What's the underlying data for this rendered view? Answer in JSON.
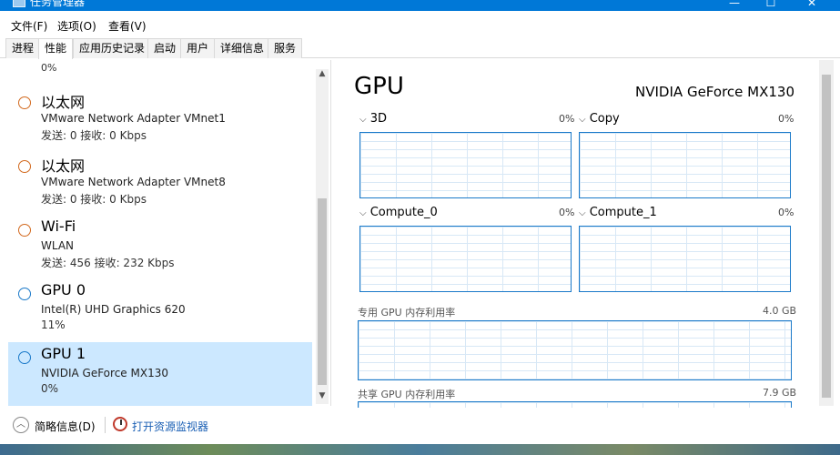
{
  "window": {
    "title": "任务管理器",
    "controls": {
      "minimize": "—",
      "maximize": "☐",
      "close": "✕"
    }
  },
  "menu": [
    "文件(F)",
    "选项(O)",
    "查看(V)"
  ],
  "tabs": [
    "进程",
    "性能",
    "应用历史记录",
    "启动",
    "用户",
    "详细信息",
    "服务"
  ],
  "active_tab": "性能",
  "left": {
    "partial_top": "0%",
    "items": [
      {
        "name": "以太网",
        "line1": "VMware Network Adapter VMnet1",
        "line2": "发送: 0 接收: 0 Kbps",
        "color": "#d2691e"
      },
      {
        "name": "以太网",
        "line1": "VMware Network Adapter VMnet8",
        "line2": "发送: 0 接收: 0 Kbps",
        "color": "#d2691e"
      },
      {
        "name": "Wi-Fi",
        "line1": "WLAN",
        "line2": "发送: 456 接收: 232 Kbps",
        "color": "#d2691e"
      },
      {
        "name": "GPU 0",
        "line1": "Intel(R) UHD Graphics 620",
        "line2": "11%",
        "color": "#1a79c9"
      },
      {
        "name": "GPU 1",
        "line1": "NVIDIA GeForce MX130",
        "line2": "0%",
        "color": "#1a79c9",
        "selected": true
      }
    ]
  },
  "right": {
    "title": "GPU",
    "gpu_name": "NVIDIA GeForce MX130",
    "engines": [
      {
        "label": "3D",
        "pct": "0%"
      },
      {
        "label": "Copy",
        "pct": "0%"
      },
      {
        "label": "Compute_0",
        "pct": "0%"
      },
      {
        "label": "Compute_1",
        "pct": "0%"
      }
    ],
    "dedicated": {
      "label": "专用 GPU 内存利用率",
      "value": "4.0 GB"
    },
    "shared": {
      "label": "共享 GPU 内存利用率",
      "value": "7.9 GB"
    }
  },
  "footer": {
    "fewer_details": "简略信息(D)",
    "open_monitor": "打开资源监视器"
  }
}
